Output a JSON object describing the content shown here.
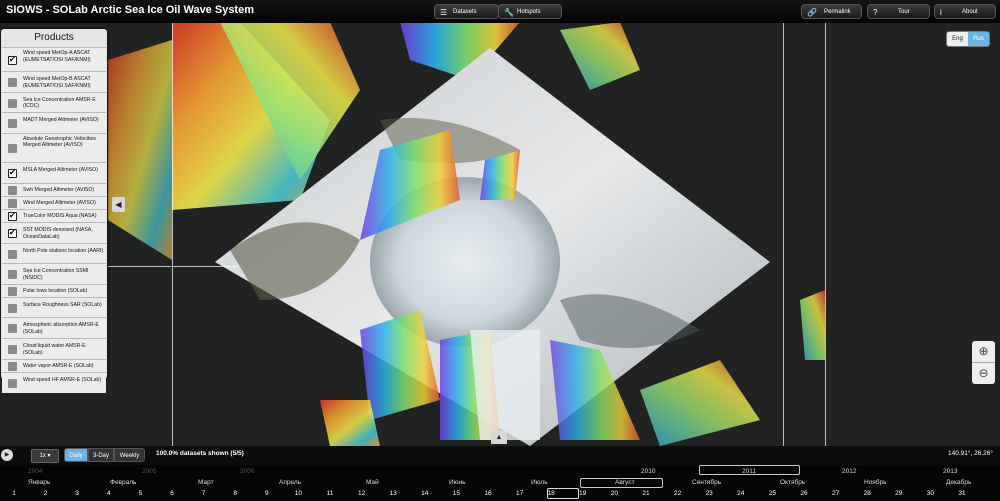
{
  "app": {
    "title": "SIOWS - SOLab Arctic Sea Ice Oil Wave System"
  },
  "topbar": {
    "datasets_label": "Datasets",
    "hotspots_label": "Hotspots",
    "permalink_label": "Permalink",
    "tour_label": "Tour",
    "about_label": "About"
  },
  "language": {
    "en": "Eng",
    "ru": "Rus",
    "selected": "Rus"
  },
  "products": {
    "title": "Products",
    "items": [
      {
        "label": "Wind speed MetOp-A ASCAT (EUMETSAT/OSI SAF/KNMI)",
        "checked": true
      },
      {
        "label": "Wind speed MetOp-B ASCAT (EUMETSAT/OSI SAF/KNMI)",
        "checked": false
      },
      {
        "label": "Sea Ice Concentration AMSR-E (ICDC)",
        "checked": false
      },
      {
        "label": "MADT Merged Altimeter (AVISO)",
        "checked": false
      },
      {
        "label": "Absolute Geostrophic Velocities Merged Altimeter (AVISO)",
        "checked": false
      },
      {
        "label": "MSLA Merged Altimeter (AVISO)",
        "checked": true
      },
      {
        "label": "Swh Merged Altimeter (AVISO)",
        "checked": false
      },
      {
        "label": "Wind Merged Altimeter (AVISO)",
        "checked": false
      },
      {
        "label": "TrueColor MODIS Aqua (NASA)",
        "checked": true
      },
      {
        "label": "SST MODIS denoised (NASA, OceanDataLab)",
        "checked": true
      },
      {
        "label": "North Pole stations location (AARI)",
        "checked": false
      },
      {
        "label": "Sea Ice Concentration SSMI (NSIDC)",
        "checked": false
      },
      {
        "label": "Polar lows location (SOLab)",
        "checked": false
      },
      {
        "label": "Surface Roughness SAR (SOLab)",
        "checked": false
      },
      {
        "label": "Atmospheric absorption AMSR-E (SOLab)",
        "checked": false
      },
      {
        "label": "Cloud liquid water AMSR-E (SOLab)",
        "checked": false
      },
      {
        "label": "Water vapor AMSR-E (SOLab)",
        "checked": false
      },
      {
        "label": "Wind speed HF AMSR-E (SOLab)",
        "checked": false
      }
    ]
  },
  "controls": {
    "speed": "1x",
    "modes": {
      "daily": "Daily",
      "three_day": "3-Day",
      "weekly": "Weekly",
      "selected": "Daily"
    },
    "datasets_shown": "100.0% datasets shown (5/5)",
    "coords": "140.91°, 26.26°"
  },
  "timeline": {
    "years": [
      {
        "label": "2004",
        "faded": true
      },
      {
        "label": "2005",
        "faded": true
      },
      {
        "label": "2006",
        "faded": true
      },
      {
        "label": "2010",
        "faded": false
      },
      {
        "label": "2011",
        "faded": false,
        "selected": true
      },
      {
        "label": "2012",
        "faded": false
      },
      {
        "label": "2013",
        "faded": false
      }
    ],
    "months": [
      "Январь",
      "Февраль",
      "Март",
      "Апрель",
      "Май",
      "Июнь",
      "Июль",
      "Август",
      "Сентябрь",
      "Октябрь",
      "Ноябрь",
      "Декабрь"
    ],
    "selected_month": "Август",
    "days": [
      "1",
      "2",
      "3",
      "4",
      "5",
      "6",
      "7",
      "8",
      "9",
      "10",
      "11",
      "12",
      "13",
      "14",
      "15",
      "16",
      "17",
      "18",
      "19",
      "20",
      "21",
      "22",
      "23",
      "24",
      "25",
      "26",
      "27",
      "28",
      "29",
      "30",
      "31"
    ],
    "selected_day": "18"
  }
}
